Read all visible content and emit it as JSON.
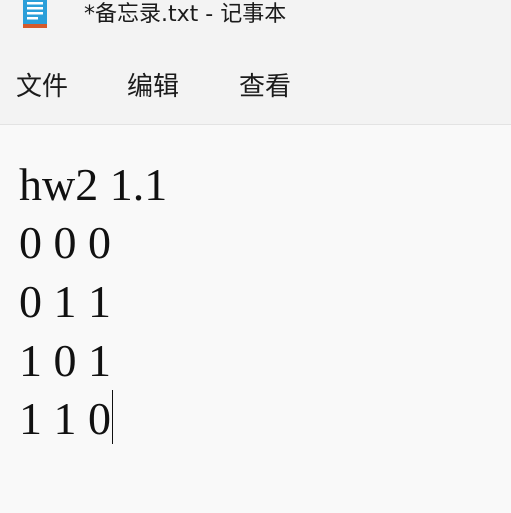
{
  "window": {
    "title": "*备忘录.txt - 记事本",
    "icon": "notepad-icon"
  },
  "menu": {
    "file_label": "文件",
    "edit_label": "编辑",
    "view_label": "查看"
  },
  "editor": {
    "lines": [
      "hw2 1.1",
      "0 0 0",
      "0 1 1",
      "1 0 1",
      "1 1 0"
    ]
  },
  "colors": {
    "background": "#f9f9f9",
    "chrome": "#f3f3f3",
    "text": "#111111",
    "icon_blue": "#2b9fd9",
    "icon_accent": "#d65a2a"
  }
}
